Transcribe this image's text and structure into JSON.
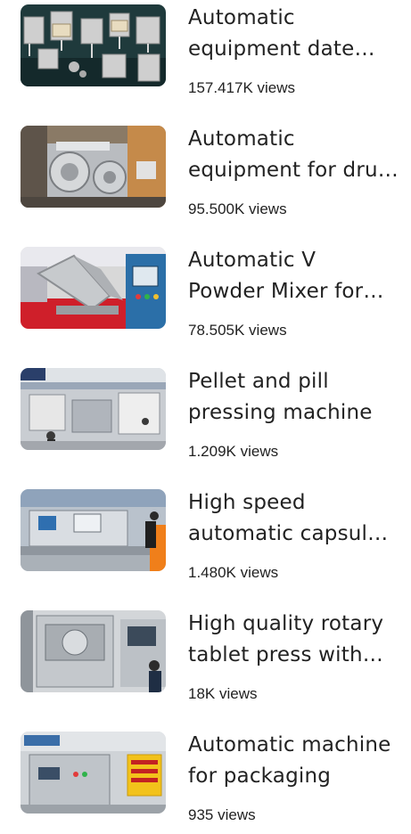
{
  "videos": [
    {
      "title": "Automatic equipment date cutter for machine",
      "views": "157.417K views",
      "thumbnail": "aluminum-molds-icon"
    },
    {
      "title": "Automatic equipment for drug manufacturing",
      "views": "95.500K views",
      "thumbnail": "stainless-rollers-icon"
    },
    {
      "title": "Automatic V Powder Mixer for pharmaceutical",
      "views": "78.505K views",
      "thumbnail": "v-mixer-icon"
    },
    {
      "title": "Pellet and pill pressing machine",
      "views": "1.209K views",
      "thumbnail": "exhibition-booth-icon"
    },
    {
      "title": "High speed automatic capsule filling",
      "views": "1.480K views",
      "thumbnail": "production-line-icon"
    },
    {
      "title": "High quality rotary tablet press with automatic",
      "views": "18K views",
      "thumbnail": "tablet-press-icon"
    },
    {
      "title": "Automatic machine for packaging",
      "views": "935 views",
      "thumbnail": "packaging-machine-icon"
    }
  ]
}
